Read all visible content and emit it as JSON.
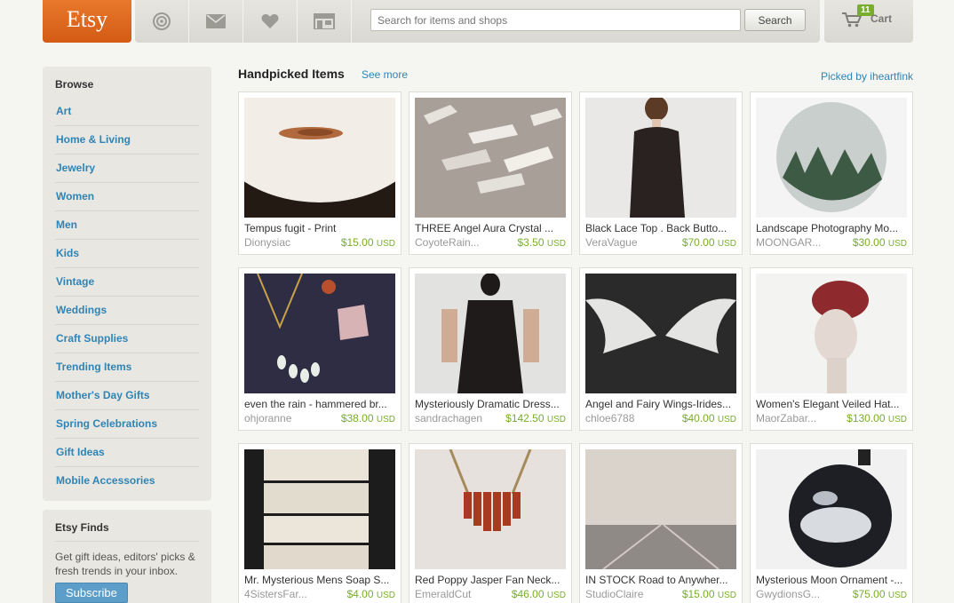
{
  "header": {
    "logo": "Etsy",
    "search_placeholder": "Search for items and shops",
    "search_button": "Search",
    "cart_count": "11",
    "cart_label": "Cart"
  },
  "sidebar": {
    "browse_title": "Browse",
    "items": [
      "Art",
      "Home & Living",
      "Jewelry",
      "Women",
      "Men",
      "Kids",
      "Vintage",
      "Weddings",
      "Craft Supplies",
      "Trending Items",
      "Mother's Day Gifts",
      "Spring Celebrations",
      "Gift Ideas",
      "Mobile Accessories"
    ],
    "finds_title": "Etsy Finds",
    "finds_text": "Get gift ideas, editors' picks & fresh trends in your inbox.",
    "subscribe_button": "Subscribe"
  },
  "main": {
    "title": "Handpicked Items",
    "see_more": "See more",
    "picked_by": "Picked by iheartfink",
    "items": [
      {
        "title": "Tempus fugit - Print",
        "shop": "Dionysiac",
        "price": "$15.00",
        "currency": "USD"
      },
      {
        "title": "THREE Angel Aura Crystal ...",
        "shop": "CoyoteRain...",
        "price": "$3.50",
        "currency": "USD"
      },
      {
        "title": "Black Lace Top . Back Butto...",
        "shop": "VeraVague",
        "price": "$70.00",
        "currency": "USD"
      },
      {
        "title": "Landscape Photography Mo...",
        "shop": "MOONGAR...",
        "price": "$30.00",
        "currency": "USD"
      },
      {
        "title": "even the rain - hammered br...",
        "shop": "ohjoranne",
        "price": "$38.00",
        "currency": "USD"
      },
      {
        "title": "Mysteriously Dramatic Dress...",
        "shop": "sandrachagen",
        "price": "$142.50",
        "currency": "USD"
      },
      {
        "title": "Angel and Fairy Wings-Irides...",
        "shop": "chloe6788",
        "price": "$40.00",
        "currency": "USD"
      },
      {
        "title": "Women's Elegant Veiled Hat...",
        "shop": "MaorZabar...",
        "price": "$130.00",
        "currency": "USD"
      },
      {
        "title": "Mr. Mysterious Mens Soap S...",
        "shop": "4SistersFar...",
        "price": "$4.00",
        "currency": "USD"
      },
      {
        "title": "Red Poppy Jasper Fan Neck...",
        "shop": "EmeraldCut",
        "price": "$46.00",
        "currency": "USD"
      },
      {
        "title": "IN STOCK Road to Anywher...",
        "shop": "StudioClaire",
        "price": "$15.00",
        "currency": "USD"
      },
      {
        "title": "Mysterious Moon Ornament -...",
        "shop": "GwydionsG...",
        "price": "$75.00",
        "currency": "USD"
      }
    ]
  }
}
